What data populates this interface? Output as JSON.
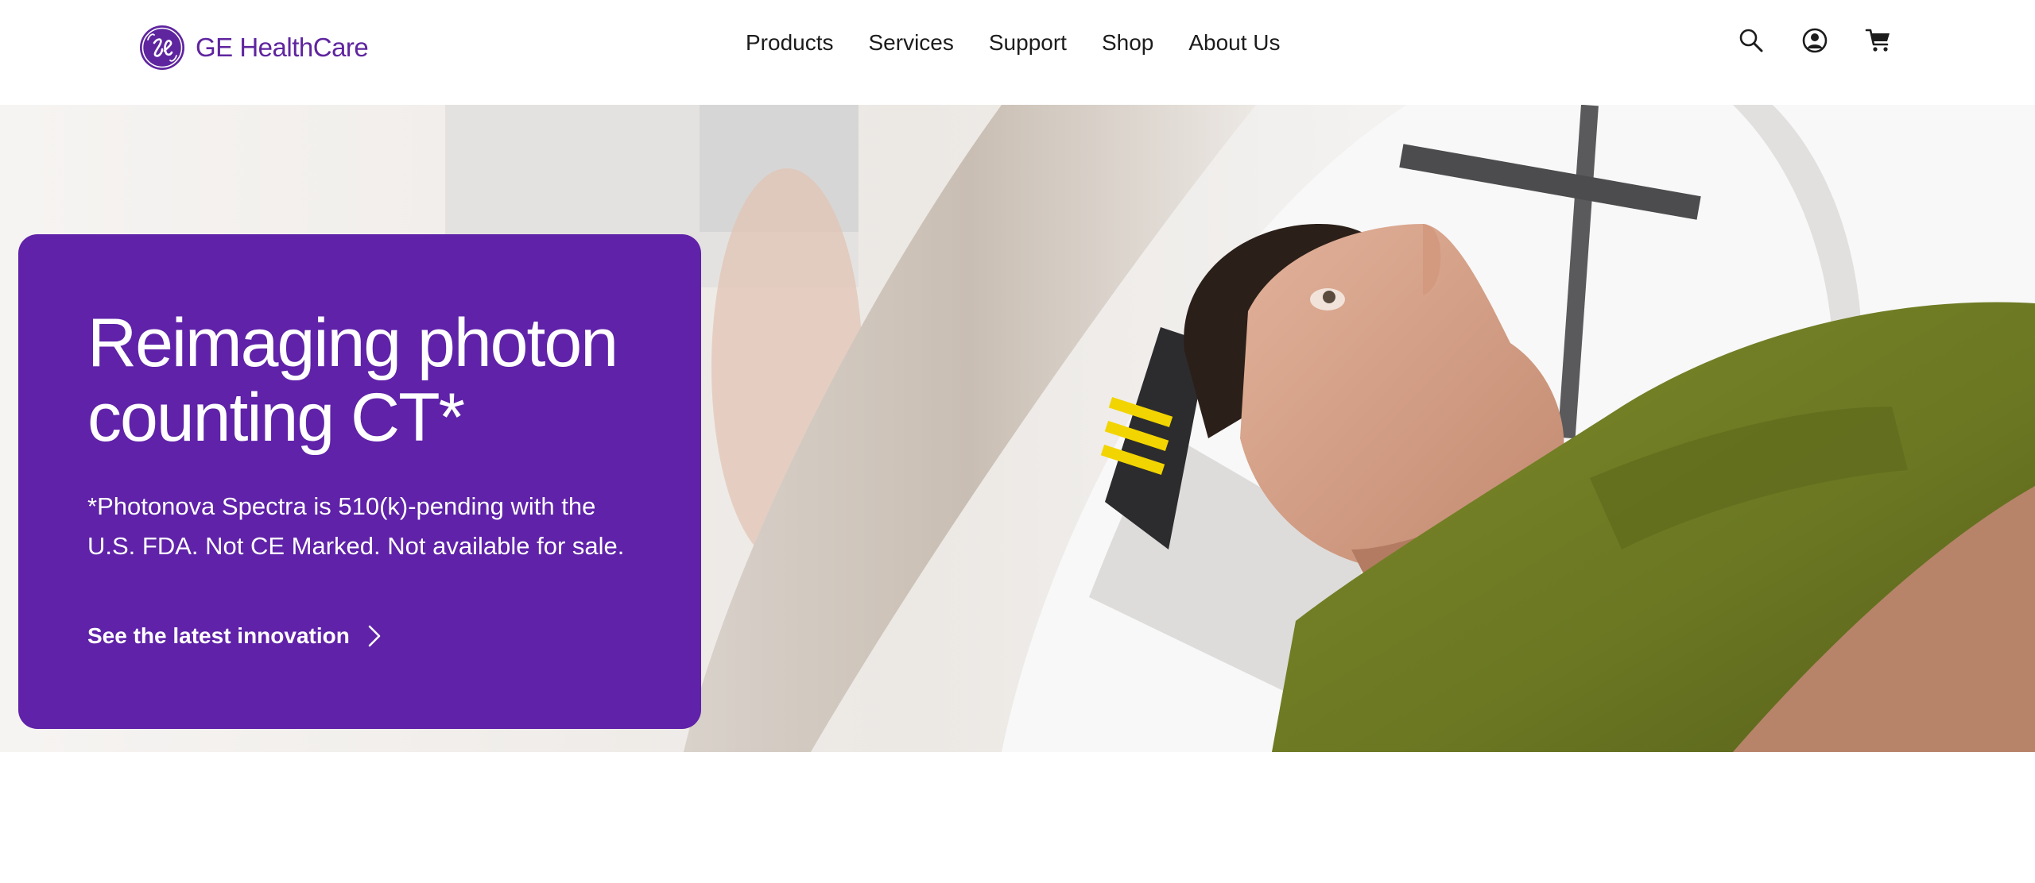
{
  "brand": {
    "name": "GE HealthCare",
    "logo_mark": "ge-monogram-logo",
    "color": "#5f259f"
  },
  "nav": {
    "items": [
      {
        "label": "Products"
      },
      {
        "label": "Services"
      },
      {
        "label": "Support"
      },
      {
        "label": "Shop"
      },
      {
        "label": "About Us"
      }
    ]
  },
  "header_icons": {
    "search": "search-icon",
    "account": "user-account-icon",
    "cart": "shopping-cart-icon"
  },
  "hero": {
    "title_line1": "Reimaging photon",
    "title_line2": "counting CT*",
    "subtitle_line1": "*Photonova Spectra is 510(k)-pending with the",
    "subtitle_line2": "U.S. FDA. Not CE Marked. Not available for sale.",
    "cta_label": "See the latest innovation",
    "cta_icon": "chevron-right-icon",
    "card_color": "#5f22a8",
    "image": "patient-lying-in-ct-scanner-photo"
  }
}
